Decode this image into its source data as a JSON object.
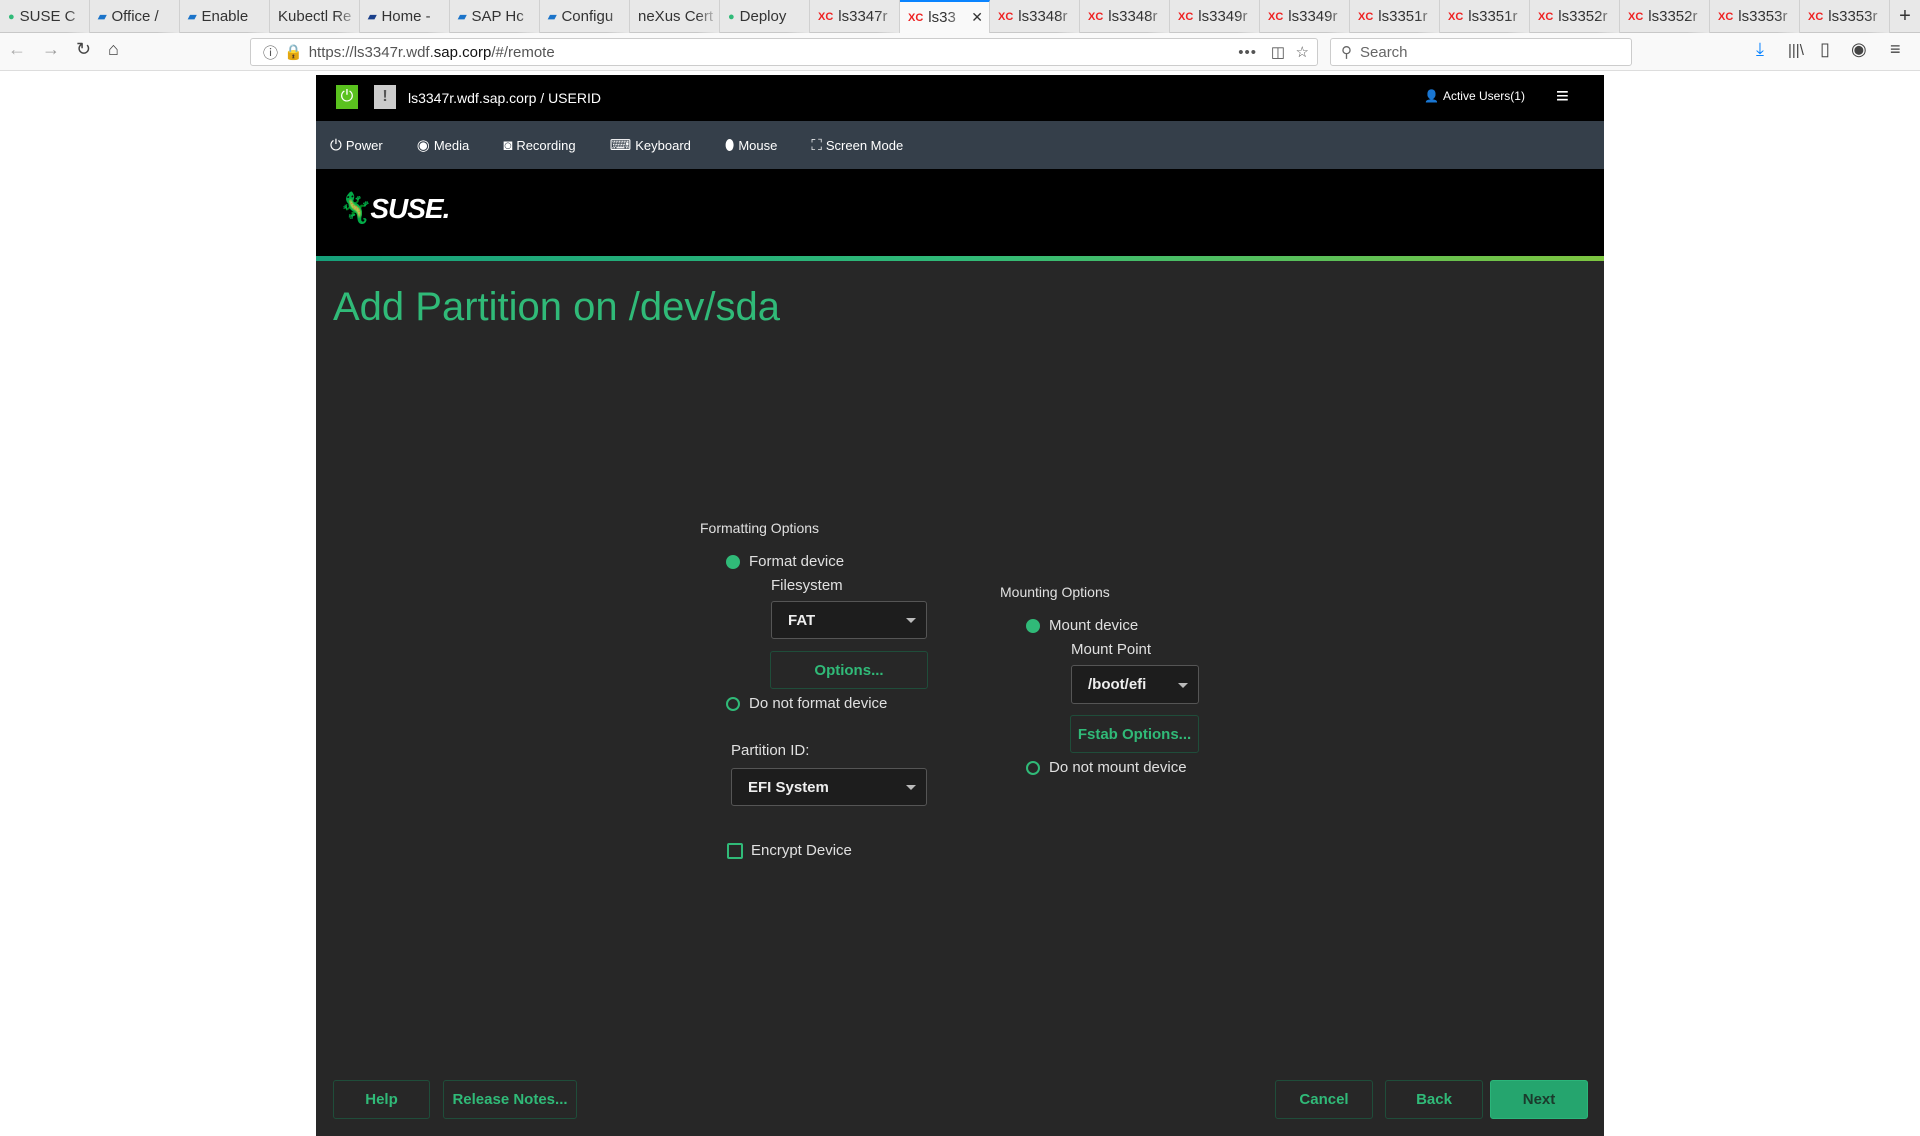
{
  "browser": {
    "tabs": [
      {
        "label": "SUSE C",
        "icon": "suse-icon",
        "ic": "●",
        "color": "#30ba78"
      },
      {
        "label": "Office /",
        "icon": "sap-icon",
        "ic": "▰",
        "color": "#1a73c9"
      },
      {
        "label": "Enable",
        "icon": "sap-icon",
        "ic": "▰",
        "color": "#1a73c9"
      },
      {
        "label": "Kubectl Re",
        "icon": "",
        "ic": "",
        "color": "#333"
      },
      {
        "label": "Home -",
        "icon": "sap-icon",
        "ic": "▰",
        "color": "#1a3f8a"
      },
      {
        "label": "SAP Hc",
        "icon": "sap-icon",
        "ic": "▰",
        "color": "#1a73c9"
      },
      {
        "label": "Configu",
        "icon": "sap-icon",
        "ic": "▰",
        "color": "#1a73c9"
      },
      {
        "label": "neXus Cert",
        "icon": "",
        "ic": "",
        "color": "#333"
      },
      {
        "label": "Deploy",
        "icon": "suse-icon",
        "ic": "●",
        "color": "#30ba78"
      },
      {
        "label": "ls3347r",
        "icon": "xc-icon",
        "ic": "XC",
        "color": "#e22"
      },
      {
        "label": "ls33",
        "icon": "xc-icon",
        "ic": "XC",
        "color": "#e22",
        "active": true
      },
      {
        "label": "ls3348r",
        "icon": "xc-icon",
        "ic": "XC",
        "color": "#e22"
      },
      {
        "label": "ls3348r",
        "icon": "xc-icon",
        "ic": "XC",
        "color": "#e22"
      },
      {
        "label": "ls3349r",
        "icon": "xc-icon",
        "ic": "XC",
        "color": "#e22"
      },
      {
        "label": "ls3349r",
        "icon": "xc-icon",
        "ic": "XC",
        "color": "#e22"
      },
      {
        "label": "ls3351r",
        "icon": "xc-icon",
        "ic": "XC",
        "color": "#e22"
      },
      {
        "label": "ls3351r",
        "icon": "xc-icon",
        "ic": "XC",
        "color": "#e22"
      },
      {
        "label": "ls3352r",
        "icon": "xc-icon",
        "ic": "XC",
        "color": "#e22"
      },
      {
        "label": "ls3352r",
        "icon": "xc-icon",
        "ic": "XC",
        "color": "#e22"
      },
      {
        "label": "ls3353r",
        "icon": "xc-icon",
        "ic": "XC",
        "color": "#e22"
      },
      {
        "label": "ls3353r",
        "icon": "xc-icon",
        "ic": "XC",
        "color": "#e22"
      }
    ],
    "url_prefix": "https://ls3347r.wdf.",
    "url_domain": "sap.corp",
    "url_suffix": "/#/remote",
    "search_placeholder": "Search"
  },
  "remote": {
    "host": "ls3347r.wdf.sap.corp / USERID",
    "active_users": "Active Users(1)",
    "toolbar": [
      "Power",
      "Media",
      "Recording",
      "Keyboard",
      "Mouse",
      "Screen Mode"
    ],
    "logo": "SUSE"
  },
  "installer": {
    "title": "Add Partition on /dev/sda",
    "formatting_options": "Formatting Options",
    "format_device": "Format device",
    "filesystem_label": "Filesystem",
    "filesystem_value": "FAT",
    "options_button": "Options...",
    "do_not_format": "Do not format device",
    "partition_id_label": "Partition ID:",
    "partition_id_value": "EFI System",
    "encrypt_device": "Encrypt Device",
    "mounting_options": "Mounting Options",
    "mount_device": "Mount device",
    "mount_point_label": "Mount Point",
    "mount_point_value": "/boot/efi",
    "fstab_options": "Fstab Options...",
    "do_not_mount": "Do not mount device",
    "format_selected": true,
    "mount_selected": true,
    "encrypt_checked": false,
    "buttons": {
      "help": "Help",
      "release_notes": "Release Notes...",
      "cancel": "Cancel",
      "back": "Back",
      "next": "Next"
    },
    "accent_color": "#30ba78"
  }
}
